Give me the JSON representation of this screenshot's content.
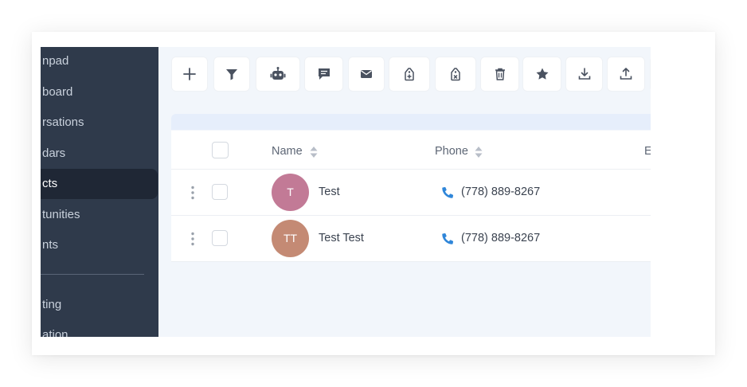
{
  "sidebar": {
    "items": [
      {
        "label": "npad"
      },
      {
        "label": "board"
      },
      {
        "label": "rsations"
      },
      {
        "label": "dars"
      },
      {
        "label": "cts"
      },
      {
        "label": "tunities"
      },
      {
        "label": "nts"
      },
      {
        "label": "ting"
      },
      {
        "label": "ation"
      }
    ],
    "active_index": 4
  },
  "toolbar": {
    "buttons": [
      {
        "icon": "plus-icon"
      },
      {
        "icon": "filter-icon"
      },
      {
        "icon": "robot-icon"
      },
      {
        "icon": "message-icon"
      },
      {
        "icon": "envelope-icon"
      },
      {
        "icon": "tag-add-icon"
      },
      {
        "icon": "tag-remove-icon"
      },
      {
        "icon": "trash-icon"
      },
      {
        "icon": "star-icon"
      },
      {
        "icon": "download-icon"
      },
      {
        "icon": "upload-icon"
      }
    ]
  },
  "table": {
    "columns": {
      "name": "Name",
      "phone": "Phone",
      "partial": "E"
    },
    "rows": [
      {
        "initials": "T",
        "name": "Test",
        "phone": "(778) 889-8267",
        "avatar_color": "#c27a96"
      },
      {
        "initials": "TT",
        "name": "Test Test",
        "phone": "(778) 889-8267",
        "avatar_color": "#c48a74"
      }
    ]
  },
  "colors": {
    "sidebar_bg": "#2f3a4b",
    "sidebar_active": "#1f2735",
    "accent_phone": "#2f86d9",
    "icon_gray": "#5b6472"
  }
}
